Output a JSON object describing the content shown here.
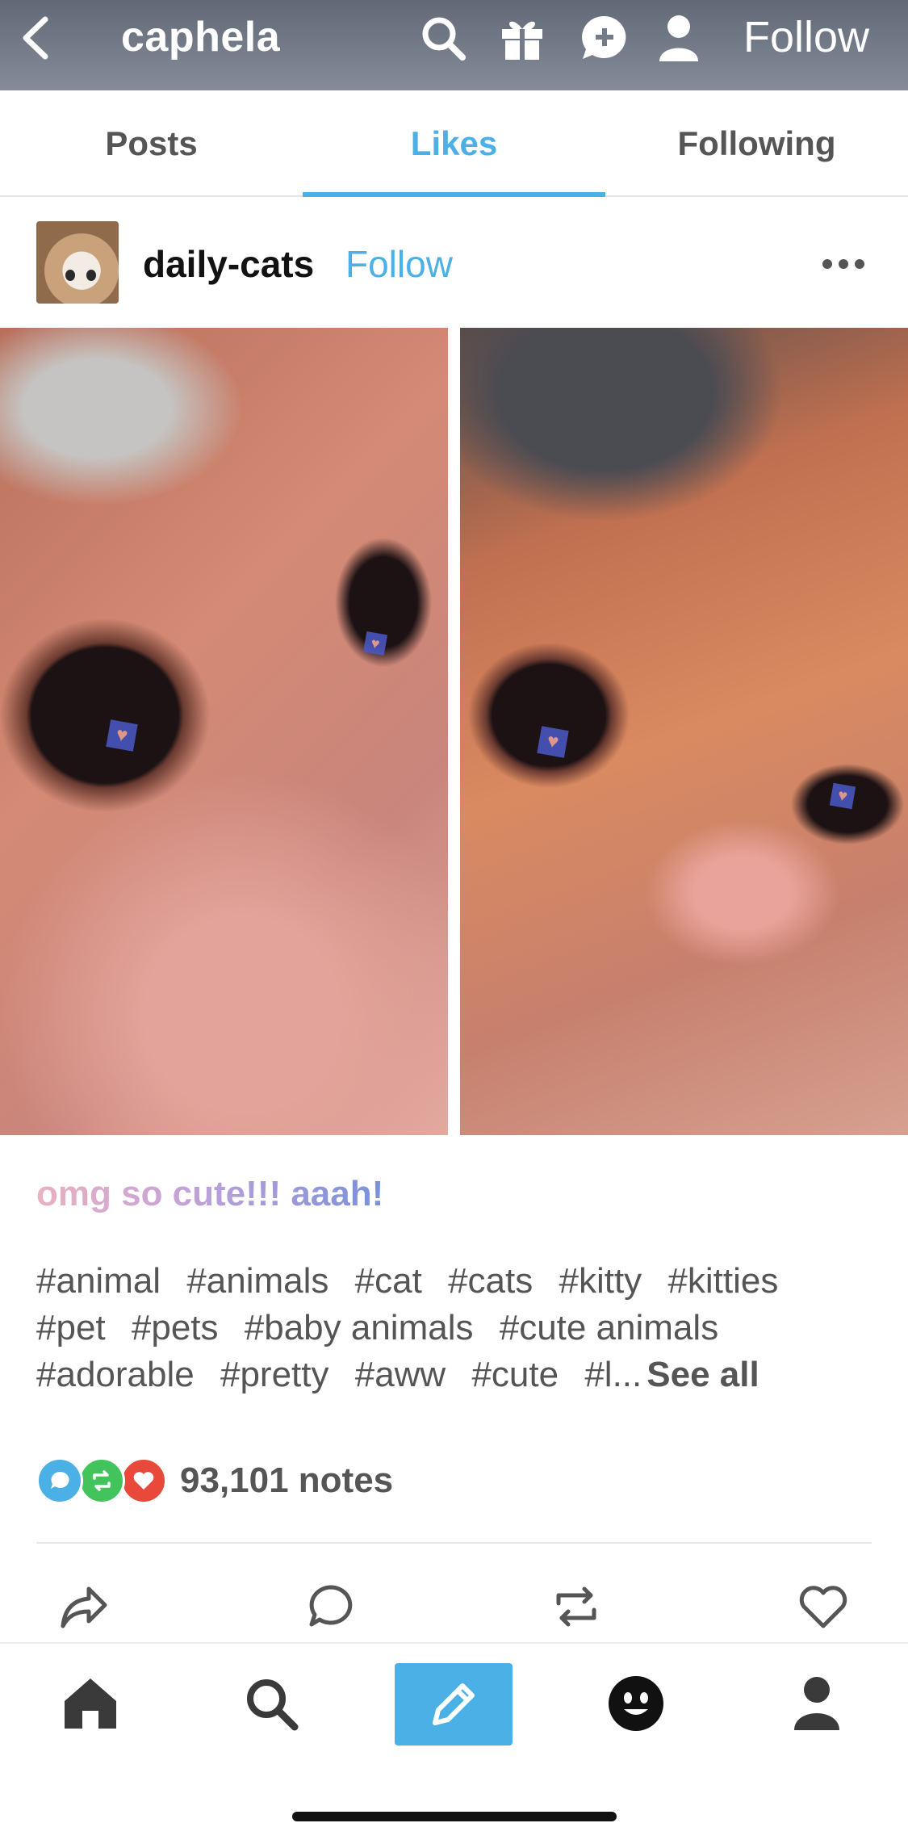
{
  "header": {
    "blog_name": "caphela",
    "follow_label": "Follow",
    "icons": [
      "back-chevron-icon",
      "search-icon",
      "gift-icon",
      "chat-plus-icon",
      "person-icon"
    ]
  },
  "tabs": [
    {
      "label": "Posts",
      "active": false
    },
    {
      "label": "Likes",
      "active": true
    },
    {
      "label": "Following",
      "active": false
    }
  ],
  "post": {
    "author": "daily-cats",
    "follow_label": "Follow",
    "caption": "omg so cute!!! aaah!",
    "tags": [
      "#animal",
      "#animals",
      "#cat",
      "#cats",
      "#kitty",
      "#kitties",
      "#pet",
      "#pets",
      "#baby animals",
      "#cute animals",
      "#adorable",
      "#pretty",
      "#aww",
      "#cute",
      "#l..."
    ],
    "see_all_label": "See all",
    "notes_count": "93,101 notes",
    "note_icon_colors": {
      "reply": "#4ab0e6",
      "reblog": "#43c35b",
      "like": "#e8493a"
    },
    "actions": [
      "share-icon",
      "comment-icon",
      "reblog-icon",
      "heart-icon"
    ]
  },
  "nav": {
    "items": [
      "home-icon",
      "search-icon",
      "compose-pencil-icon",
      "activity-face-icon",
      "account-icon"
    ],
    "accent": "#4ab0e6"
  }
}
